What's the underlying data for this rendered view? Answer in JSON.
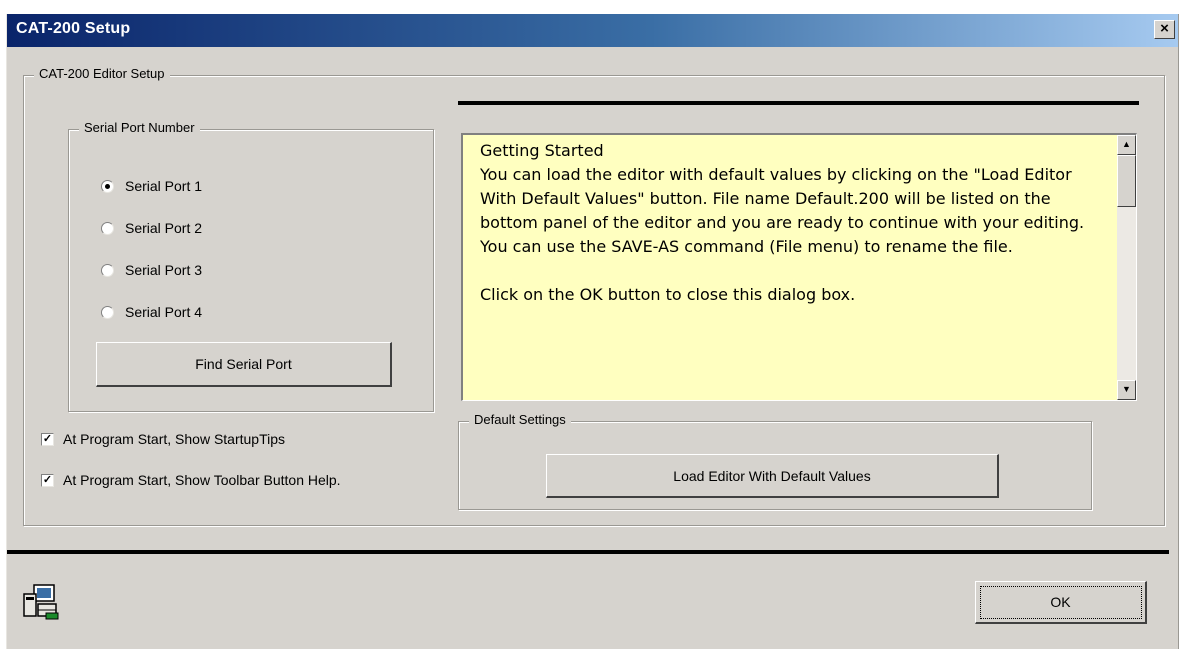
{
  "window": {
    "title": "CAT-200 Setup",
    "close_glyph": "×"
  },
  "editor_setup": {
    "legend": "CAT-200 Editor Setup"
  },
  "serial_port": {
    "legend": "Serial Port Number",
    "options": [
      {
        "label": "Serial Port 1",
        "selected": true
      },
      {
        "label": "Serial Port 2",
        "selected": false
      },
      {
        "label": "Serial Port 3",
        "selected": false
      },
      {
        "label": "Serial Port 4",
        "selected": false
      }
    ],
    "find_button_label": "Find Serial Port"
  },
  "checkboxes": [
    {
      "label": "At Program Start, Show StartupTips",
      "checked": true
    },
    {
      "label": "At Program Start, Show Toolbar Button Help.",
      "checked": true
    }
  ],
  "info_panel": {
    "heading": "Getting Started",
    "paragraph1": "You can load the editor with default values by clicking on the \"Load Editor With Default Values\" button. File name Default.200 will be listed on the bottom panel of the editor and you are ready to continue with your editing.  You can use the SAVE-AS command (File menu) to rename the file.",
    "paragraph2": "Click on the OK button to close this dialog box.",
    "background_color": "#ffffc0"
  },
  "default_settings": {
    "legend": "Default Settings",
    "load_button_label": "Load Editor With Default Values"
  },
  "footer": {
    "app_icon": "setup-app-icon",
    "ok_button_label": "OK"
  },
  "colors": {
    "dialog_face": "#d6d3ce",
    "title_gradient_start": "#0a246a",
    "title_gradient_end": "#a6caf0"
  }
}
